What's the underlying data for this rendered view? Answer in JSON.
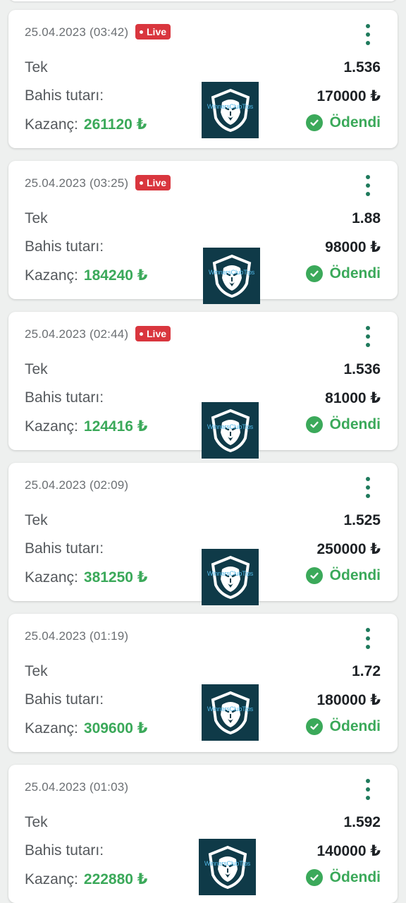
{
  "labels": {
    "bet_type": "Tek",
    "stake_label": "Bahis tutarı:",
    "win_label": "Kazanç:",
    "paid_status": "Ödendi",
    "live_badge": "Live",
    "watermark": "WinnersClubTips"
  },
  "colors": {
    "live_red": "#d9363e",
    "win_green": "#3ba95a",
    "menu_green": "#1f7a5c",
    "logo_bg": "#0f3a48"
  },
  "icons": {
    "menu": "more-vertical-icon",
    "paid": "check-circle-icon",
    "logo": "lion-shield-logo"
  },
  "bets": [
    {
      "date": "25.04.2023 (03:42)",
      "live": true,
      "odds": "1.536",
      "stake": "170000 ₺",
      "win": "261120 ₺"
    },
    {
      "date": "25.04.2023 (03:25)",
      "live": true,
      "odds": "1.88",
      "stake": "98000 ₺",
      "win": "184240 ₺"
    },
    {
      "date": "25.04.2023 (02:44)",
      "live": true,
      "odds": "1.536",
      "stake": "81000 ₺",
      "win": "124416 ₺"
    },
    {
      "date": "25.04.2023 (02:09)",
      "live": false,
      "odds": "1.525",
      "stake": "250000 ₺",
      "win": "381250 ₺"
    },
    {
      "date": "25.04.2023 (01:19)",
      "live": false,
      "odds": "1.72",
      "stake": "180000 ₺",
      "win": "309600 ₺"
    },
    {
      "date": "25.04.2023 (01:03)",
      "live": false,
      "odds": "1.592",
      "stake": "140000 ₺",
      "win": "222880 ₺"
    }
  ]
}
